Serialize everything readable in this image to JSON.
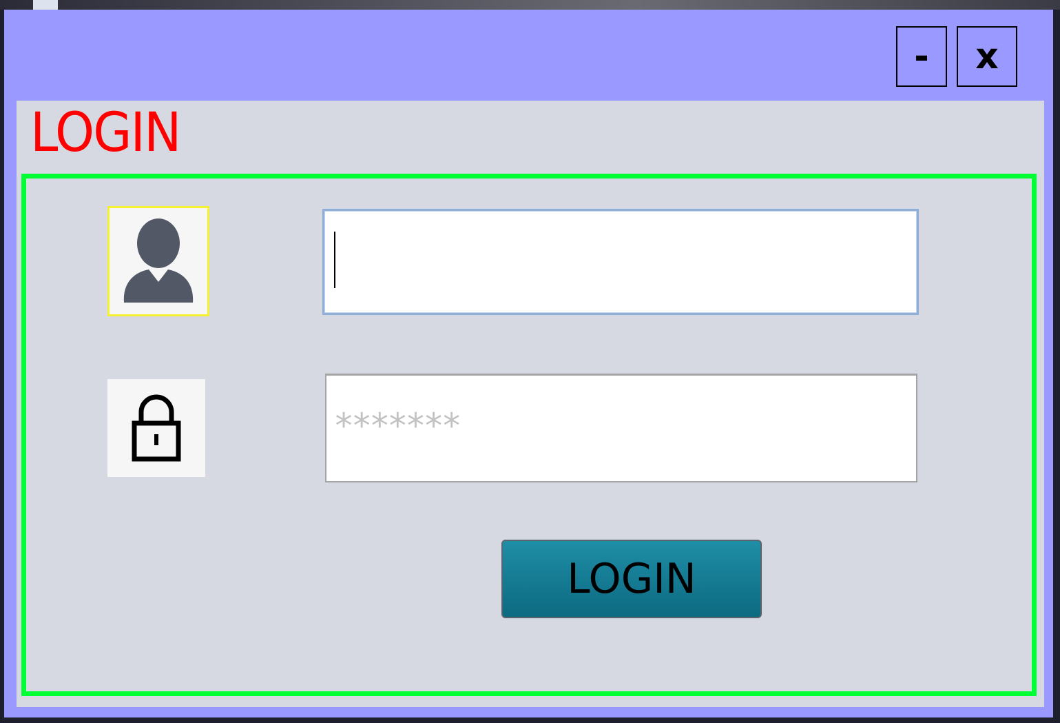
{
  "window": {
    "minimize_label": "-",
    "close_label": "x",
    "title_bar_color": "#9999ff"
  },
  "page": {
    "title": "LOGIN",
    "title_color": "#ff0000",
    "form_border_color": "#00ff33"
  },
  "username": {
    "icon": "user-icon",
    "value": ""
  },
  "password": {
    "icon": "lock-icon",
    "masked_value": "*******"
  },
  "login_button": {
    "label": "LOGIN",
    "color": "#147a92"
  }
}
